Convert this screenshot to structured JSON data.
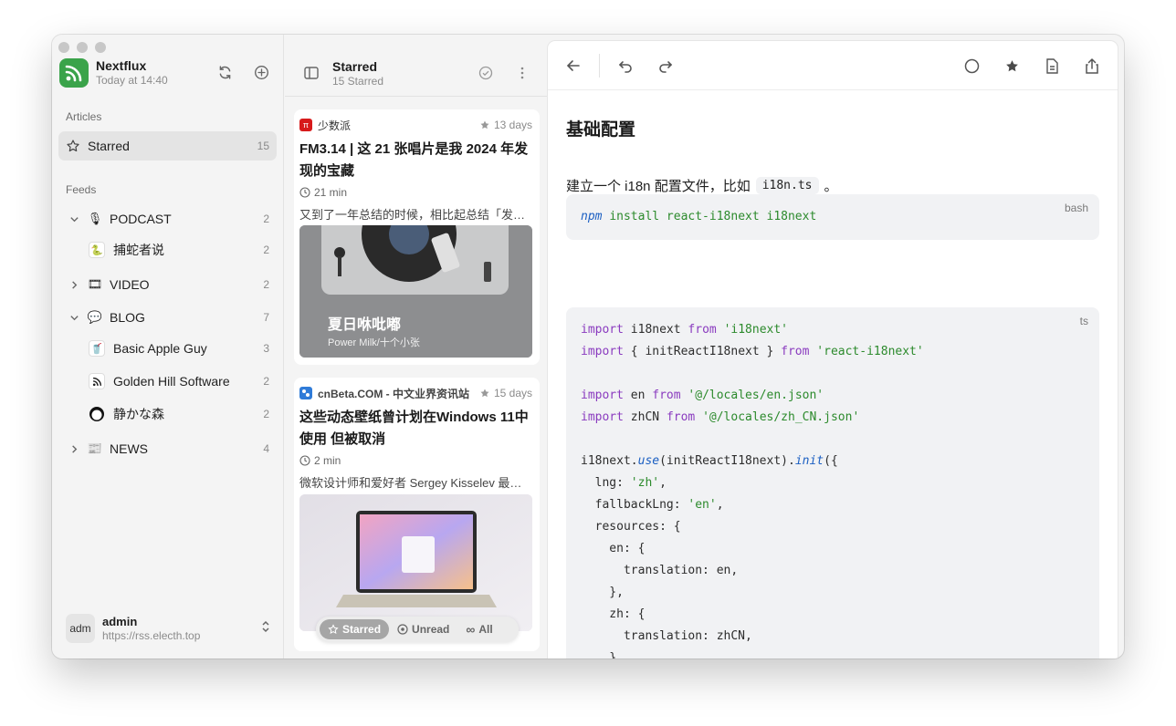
{
  "app": {
    "name": "Nextflux",
    "updated": "Today at 14:40"
  },
  "sidebar": {
    "articles_label": "Articles",
    "starred": {
      "label": "Starred",
      "count": "15"
    },
    "feeds_label": "Feeds",
    "feeds": [
      {
        "label": "PODCAST",
        "count": "2",
        "icon": "microphone-emoji",
        "expanded": true
      },
      {
        "label": "捕蛇者说",
        "count": "2",
        "icon": "snake-catcher-icon",
        "child": true
      },
      {
        "label": "VIDEO",
        "count": "2",
        "icon": "film-emoji",
        "expanded": false
      },
      {
        "label": "BLOG",
        "count": "7",
        "icon": "speech-bubble-emoji",
        "expanded": true
      },
      {
        "label": "Basic Apple Guy",
        "count": "3",
        "icon": "basic-apple-guy-icon",
        "child": true
      },
      {
        "label": "Golden Hill Software",
        "count": "2",
        "icon": "rss-icon",
        "child": true
      },
      {
        "label": "静かな森",
        "count": "2",
        "icon": "circle-logo-icon",
        "child": true
      },
      {
        "label": "NEWS",
        "count": "4",
        "icon": "newspaper-emoji",
        "expanded": false
      }
    ],
    "user": {
      "avatar": "adm",
      "name": "admin",
      "url": "https://rss.electh.top"
    }
  },
  "list": {
    "title": "Starred",
    "subtitle": "15 Starred",
    "cards": [
      {
        "source": "少数派",
        "date": "13 days",
        "title": "FM3.14 | 这 21 张唱片是我 2024 年发现的宝藏",
        "read_time": "21 min",
        "excerpt": "又到了一年总结的时候，相比起总结「发…",
        "image_caption_title": "夏日咻吡嘟",
        "image_caption_sub": "Power Milk/十个小张"
      },
      {
        "source": "cnBeta.COM - 中文业界资讯站",
        "date": "15 days",
        "title": "这些动态壁纸曾计划在Windows 11中使用 但被取消",
        "read_time": "2 min",
        "excerpt": "微软设计师和爱好者 Sergey Kisselev 最…"
      }
    ],
    "filters": [
      {
        "label": "Starred",
        "active": true
      },
      {
        "label": "Unread",
        "active": false
      },
      {
        "label": "All",
        "active": false
      }
    ]
  },
  "reader": {
    "heading": "基础配置",
    "code1_lang": "bash",
    "para_prefix": "建立一个 i18n 配置文件，比如",
    "para_code": "i18n.ts",
    "para_suffix": "。",
    "code2_lang": "ts"
  },
  "colors": {
    "accent": "#3aa34a",
    "keyword": "#8a3bbf",
    "string": "#2c8a2c",
    "function": "#1b5fc2"
  }
}
